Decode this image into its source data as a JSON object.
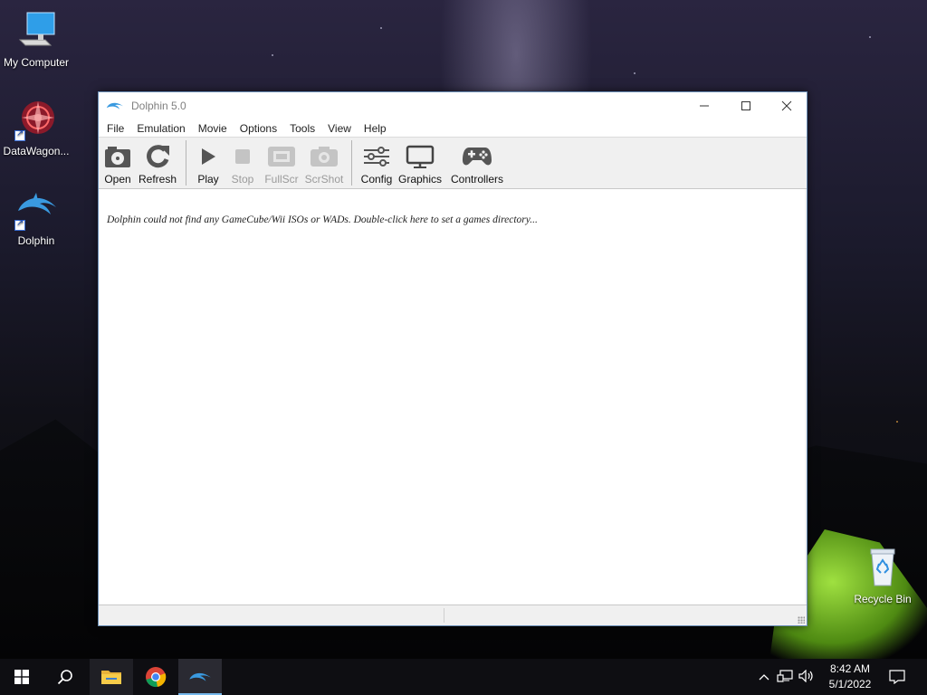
{
  "desktop": {
    "icons": [
      {
        "label": "My Computer",
        "icon": "computer-icon"
      },
      {
        "label": "DataWagon...",
        "icon": "datawagon-icon"
      },
      {
        "label": "Dolphin",
        "icon": "dolphin-icon"
      },
      {
        "label": "Recycle Bin",
        "icon": "recycle-bin-icon"
      }
    ]
  },
  "window": {
    "title": "Dolphin 5.0",
    "menu": [
      "File",
      "Emulation",
      "Movie",
      "Options",
      "Tools",
      "View",
      "Help"
    ],
    "toolbar": {
      "open": "Open",
      "refresh": "Refresh",
      "play": "Play",
      "stop": "Stop",
      "fullscr": "FullScr",
      "scrshot": "ScrShot",
      "config": "Config",
      "graphics": "Graphics",
      "controllers": "Controllers"
    },
    "message": "Dolphin could not find any GameCube/Wii ISOs or WADs. Double-click here to set a games directory..."
  },
  "taskbar": {
    "apps": [
      "start-icon",
      "search-icon",
      "file-explorer-icon",
      "chrome-icon",
      "dolphin-icon"
    ],
    "time": "8:42 AM",
    "date": "5/1/2022"
  },
  "colors": {
    "dolphin_blue": "#3a9ae0",
    "taskbar_accent": "#76b9ed"
  }
}
